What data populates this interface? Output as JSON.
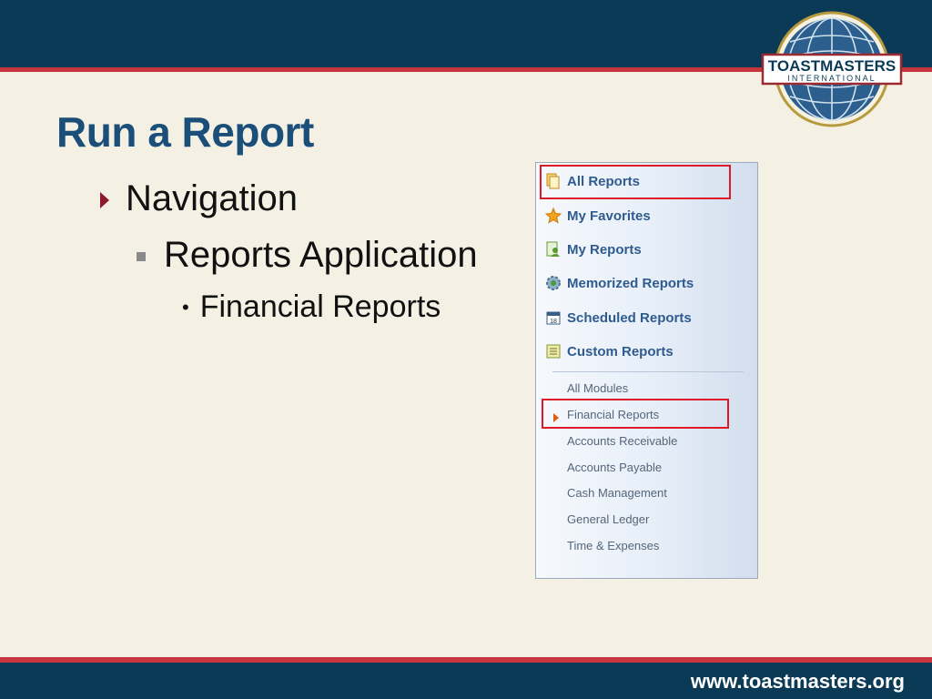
{
  "slide": {
    "title": "Run a Report",
    "bullet1": "Navigation",
    "bullet2": "Reports Application",
    "bullet3": "Financial Reports"
  },
  "logo": {
    "line1": "TOASTMASTERS",
    "line2": "INTERNATIONAL"
  },
  "footer": {
    "url": "www.toastmasters.org"
  },
  "reports_nav": {
    "items": [
      {
        "label": "All Reports",
        "icon": "copy-icon",
        "highlighted": true
      },
      {
        "label": "My Favorites",
        "icon": "star-icon"
      },
      {
        "label": "My Reports",
        "icon": "user-report-icon"
      },
      {
        "label": "Memorized Reports",
        "icon": "gear-icon"
      },
      {
        "label": "Scheduled Reports",
        "icon": "calendar-icon"
      },
      {
        "label": "Custom Reports",
        "icon": "list-icon"
      }
    ],
    "modules": [
      {
        "label": "All Modules"
      },
      {
        "label": "Financial Reports",
        "selected": true,
        "highlighted": true
      },
      {
        "label": "Accounts Receivable"
      },
      {
        "label": "Accounts Payable"
      },
      {
        "label": "Cash Management"
      },
      {
        "label": "General Ledger"
      },
      {
        "label": "Time & Expenses"
      }
    ]
  },
  "colors": {
    "header_bar": "#0b3a57",
    "accent_red": "#c9353f",
    "title_blue": "#1b4f7a",
    "highlight_box": "#e0192a"
  }
}
